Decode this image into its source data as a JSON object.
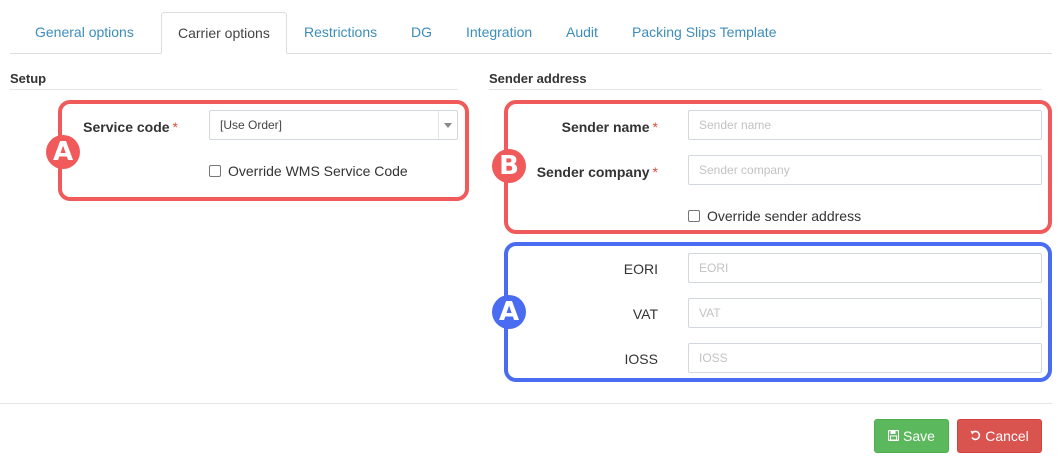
{
  "tabs": [
    {
      "label": "General options"
    },
    {
      "label": "Carrier options"
    },
    {
      "label": "Restrictions"
    },
    {
      "label": "DG"
    },
    {
      "label": "Integration"
    },
    {
      "label": "Audit"
    },
    {
      "label": "Packing Slips Template"
    }
  ],
  "active_tab": "Carrier options",
  "setup": {
    "title": "Setup",
    "service_code_label": "Service code",
    "service_code_value": "[Use Order]",
    "override_wms_label": "Override WMS Service Code"
  },
  "sender": {
    "title": "Sender address",
    "name_label": "Sender name",
    "name_placeholder": "Sender name",
    "company_label": "Sender company",
    "company_placeholder": "Sender company",
    "override_label": "Override sender address",
    "eori_label": "EORI",
    "eori_placeholder": "EORI",
    "vat_label": "VAT",
    "vat_placeholder": "VAT",
    "ioss_label": "IOSS",
    "ioss_placeholder": "IOSS"
  },
  "required_marker": "*",
  "annotations": {
    "badge_a1": "A",
    "badge_b": "B",
    "badge_a2": "A",
    "red_color": "#f05a5a",
    "blue_color": "#4a6cf0"
  },
  "footer": {
    "save_label": "Save",
    "cancel_label": "Cancel",
    "save_icon": "save-icon",
    "cancel_icon": "undo-icon"
  }
}
